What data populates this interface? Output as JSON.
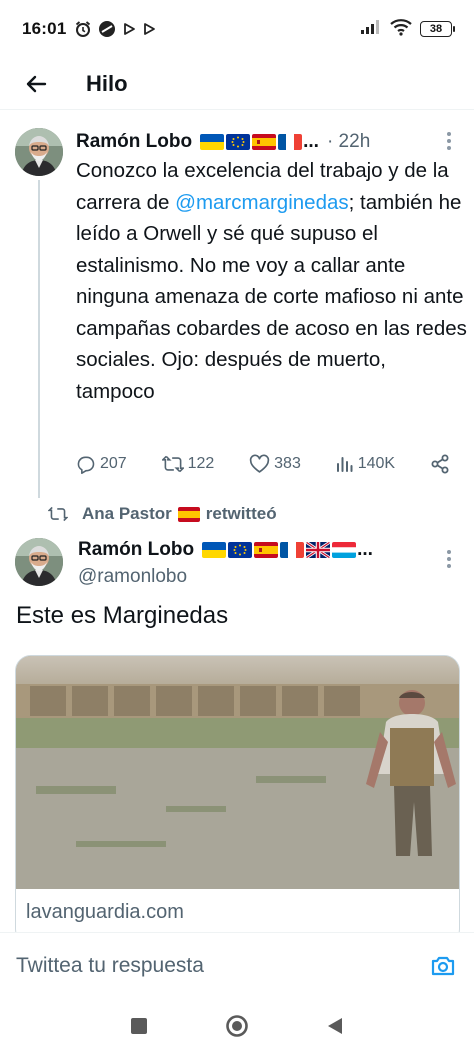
{
  "status_bar": {
    "time": "16:01",
    "battery": "38"
  },
  "header": {
    "title": "Hilo"
  },
  "tweet1": {
    "author": "Ramón Lobo",
    "time_ago": "· 22h",
    "text_before": "Conozco la excelencia del trabajo y de la carrera de ",
    "mention": "@marcmarginedas",
    "text_after": "; también he leído a Orwell y sé qué supuso el estalinismo. No me voy a callar ante ninguna amenaza de corte mafioso ni ante campañas cobardes de acoso en las redes sociales. Ojo: después de muerto, tampoco",
    "replies": "207",
    "retweets": "122",
    "likes": "383",
    "views": "140K",
    "ellipsis": "..."
  },
  "retweet_banner": {
    "retweeter": "Ana Pastor",
    "label": "retwitteó"
  },
  "tweet2": {
    "author": "Ramón Lobo",
    "handle": "@ramonlobo",
    "text": "Este es Marginedas",
    "ellipsis": "...",
    "card_domain": "lavanguardia.com"
  },
  "reply_bar": {
    "placeholder": "Twittea tu respuesta"
  },
  "colors": {
    "accent": "#1d9bf0",
    "secondary_text": "#536471",
    "border": "#cfd9de"
  }
}
